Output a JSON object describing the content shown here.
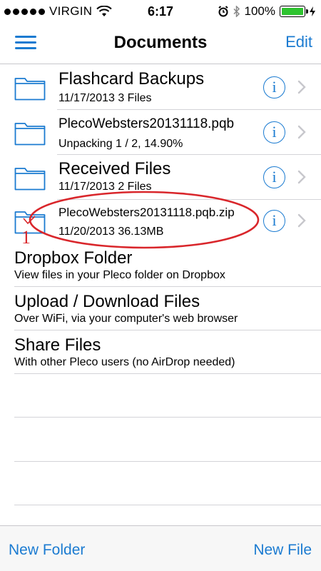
{
  "status_bar": {
    "carrier": "VIRGIN",
    "time": "6:17",
    "battery": "100%",
    "icons": [
      "signal-dots-icon",
      "wifi-icon",
      "alarm-icon",
      "bluetooth-icon",
      "battery-icon",
      "charging-bolt-icon"
    ],
    "battery_color": "#2fc430"
  },
  "nav": {
    "title": "Documents",
    "edit_label": "Edit",
    "menu_icon": "hamburger-menu-icon"
  },
  "files": [
    {
      "name": "Flashcard Backups",
      "sub": "11/17/2013  3 Files",
      "kind": "folder"
    },
    {
      "name": "PlecoWebsters20131118.pqb",
      "sub": "Unpacking 1 / 2, 14.90%",
      "kind": "folder"
    },
    {
      "name": "Received Files",
      "sub": "11/17/2013  2 Files",
      "kind": "folder"
    },
    {
      "name": "PlecoWebsters20131118.pqb.zip",
      "sub": "11/20/2013  36.13MB",
      "kind": "folder"
    }
  ],
  "annotation": {
    "number": "1",
    "color": "#d9262b"
  },
  "actions": [
    {
      "title": "Dropbox Folder",
      "sub": "View files in your Pleco folder on Dropbox"
    },
    {
      "title": "Upload / Download Files",
      "sub": "Over WiFi, via your computer's web browser"
    },
    {
      "title": "Share Files",
      "sub": "With other Pleco users (no AirDrop needed)"
    }
  ],
  "toolbar": {
    "new_folder_label": "New Folder",
    "new_file_label": "New File"
  },
  "accent_color": "#1b7bd1"
}
